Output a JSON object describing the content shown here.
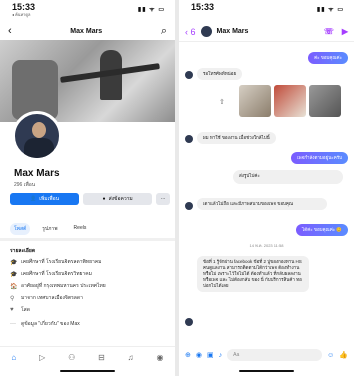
{
  "left": {
    "status": {
      "time": "15:33",
      "sub": "◂ ค้นหาดูล",
      "icons": "▮▮ ᯤ ▭"
    },
    "nav": {
      "title": "Max Mars",
      "back": "‹",
      "search": "⌕"
    },
    "profile": {
      "name": "Max Mars",
      "friends": "296 เพื่อน"
    },
    "buttons": {
      "add_friend": "เพิ่มเพื่อน",
      "message": "ส่งข้อความ",
      "more": "···"
    },
    "tabs": [
      "โพสต์",
      "รูปภาพ",
      "Reels"
    ],
    "details": {
      "heading": "รายละเอียด",
      "rows": [
        {
          "icon": "🎓",
          "text": "เคยศึกษาที่ โรงเรียนจิตรลดาพิทยาคม"
        },
        {
          "icon": "🎓",
          "text": "เคยศึกษาที่ โรงเรียนจิตรวิทยาคม"
        },
        {
          "icon": "🏠",
          "text": "อาศัยอยู่ที่ กรุงเทพมหานคร ประเทศไทย"
        },
        {
          "icon": "⚲",
          "text": "มาจาก เทศบาลเมืองจิตรลดา"
        },
        {
          "icon": "♥",
          "text": "โสด"
        },
        {
          "icon": "···",
          "text": "ดูข้อมูล \"เกี่ยวกับ\" ของ Max"
        }
      ]
    },
    "bottom_nav": [
      "⌂",
      "▷",
      "⚇",
      "⊟",
      "♫",
      "◉"
    ]
  },
  "right": {
    "status": {
      "time": "15:33",
      "icons": "▮▮ ᯤ ▭"
    },
    "nav": {
      "back": "‹ 6",
      "title": "Max Mars",
      "call": "☏",
      "video": "▶"
    },
    "messages": [
      {
        "kind": "out",
        "text": "ค่ะ ขอบคุณค่ะ"
      },
      {
        "kind": "in",
        "text": "รอโทรศัพท์หน่อย"
      },
      {
        "kind": "in",
        "text": "ผม หาใช้ ของงาน เมื่อช่วงใกล้ไปนี้"
      },
      {
        "kind": "out",
        "text": "เพจกำลังตามอยู่นะครับ"
      },
      {
        "kind": "in",
        "text": "ส่งรูปไปค่ะ"
      },
      {
        "kind": "in",
        "text": "เดาแล้วไม่ถือ และมีภาพสนามของเพจ ขอบคุณ"
      },
      {
        "kind": "out",
        "text": "ได้ค่ะ ขอบคุณค่ะ 😊"
      },
      {
        "kind": "in",
        "text": "ข้อที่ 1 รู้จักผ่าน facebook ข้อที่ 2 ปูของกองทาน HS คนดูแลงาน สามารถติดตามได้กว่าเพจ ต้องทำงานหรือไม่ เพราะไว้ใจไม่ได้ ต้องทำแล้ว ที่กลับผลลงานหรือเพจ และ ไม่ต้องกลับ ของ นี่ กับบริการสินค้า ทอปอกไปได้เลย"
      }
    ],
    "timestamp": "14 พ.ค. 2023 11:58",
    "composer": {
      "placeholder": "Aa"
    }
  }
}
